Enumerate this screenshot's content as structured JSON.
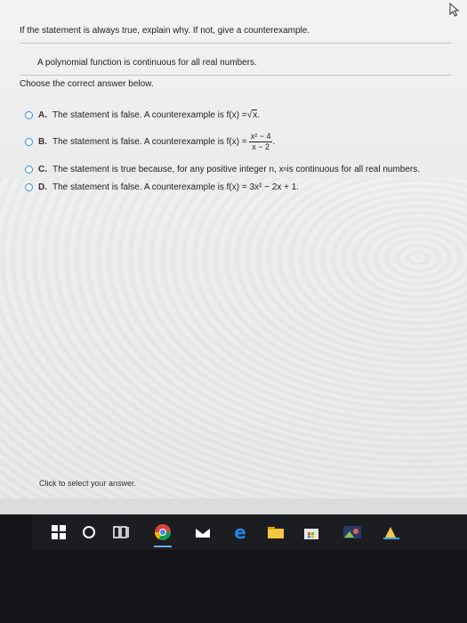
{
  "question": {
    "instruction": "If the statement is always true, explain why. If not, give a counterexample.",
    "statement": "A polynomial function is continuous for all real numbers.",
    "choose_label": "Choose the correct answer below."
  },
  "options": [
    {
      "letter": "A.",
      "text": "The statement is false. A counterexample is f(x) = ",
      "math": "x",
      "math_suffix": "."
    },
    {
      "letter": "B.",
      "text": "The statement is false. A counterexample is f(x) = ",
      "numerator": "x² − 4",
      "denominator": "x − 2",
      "math_suffix": "."
    },
    {
      "letter": "C.",
      "text": "The statement is true because, for any positive integer n, x",
      "superscript": "n",
      "text_after": " is continuous for all real numbers."
    },
    {
      "letter": "D.",
      "text": "The statement is false. A counterexample is f(x) = 3x² − 2x + 1."
    }
  ],
  "footer": {
    "help_text": "Click to select your answer."
  },
  "colors": {
    "radio_border": "#2f8fd6",
    "taskbar": "#1c1d21"
  },
  "taskbar_icons": [
    "windows-start-icon",
    "search-cortana-icon",
    "task-view-icon",
    "chrome-icon",
    "mail-icon",
    "edge-icon",
    "file-explorer-icon",
    "store-icon",
    "photos-icon",
    "sketch-app-icon"
  ]
}
